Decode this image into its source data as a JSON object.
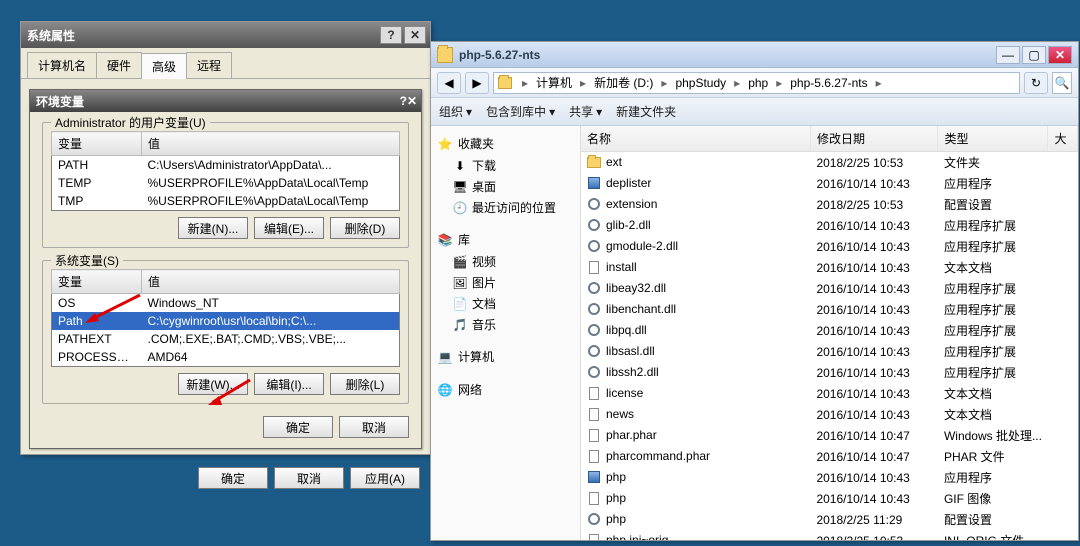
{
  "sysprops": {
    "title": "系统属性",
    "tabs": [
      "计算机名",
      "硬件",
      "高级",
      "远程"
    ],
    "active_tab": 2,
    "envdlg": {
      "title": "环境变量",
      "user_group_label": "Administrator 的用户变量(U)",
      "sys_group_label": "系统变量(S)",
      "col_var": "变量",
      "col_val": "值",
      "user_vars": [
        {
          "name": "PATH",
          "value": "C:\\Users\\Administrator\\AppData\\..."
        },
        {
          "name": "TEMP",
          "value": "%USERPROFILE%\\AppData\\Local\\Temp"
        },
        {
          "name": "TMP",
          "value": "%USERPROFILE%\\AppData\\Local\\Temp"
        }
      ],
      "sys_vars": [
        {
          "name": "OS",
          "value": "Windows_NT"
        },
        {
          "name": "Path",
          "value": "C:\\cygwinroot\\usr\\local\\bin;C:\\..."
        },
        {
          "name": "PATHEXT",
          "value": ".COM;.EXE;.BAT;.CMD;.VBS;.VBE;..."
        },
        {
          "name": "PROCESSOR_AR...",
          "value": "AMD64"
        }
      ],
      "sys_selected": 1,
      "btn_new_u": "新建(N)...",
      "btn_edit_u": "编辑(E)...",
      "btn_del_u": "删除(D)",
      "btn_new_s": "新建(W)...",
      "btn_edit_s": "编辑(I)...",
      "btn_del_s": "删除(L)",
      "btn_ok": "确定",
      "btn_cancel": "取消"
    },
    "btn_ok": "确定",
    "btn_cancel": "取消",
    "btn_apply": "应用(A)"
  },
  "explorer": {
    "title": "php-5.6.27-nts",
    "breadcrumb": [
      "计算机",
      "新加卷 (D:)",
      "phpStudy",
      "php",
      "php-5.6.27-nts"
    ],
    "toolbar": {
      "organize": "组织",
      "include": "包含到库中",
      "share": "共享",
      "newfolder": "新建文件夹"
    },
    "nav": {
      "favorites": "收藏夹",
      "fav_items": [
        "下载",
        "桌面",
        "最近访问的位置"
      ],
      "libraries": "库",
      "lib_items": [
        "视频",
        "图片",
        "文档",
        "音乐"
      ],
      "computer": "计算机",
      "network": "网络"
    },
    "columns": {
      "name": "名称",
      "date": "修改日期",
      "type": "类型",
      "size": "大"
    },
    "files": [
      {
        "icon": "folder",
        "name": "ext",
        "date": "2018/2/25 10:53",
        "type": "文件夹"
      },
      {
        "icon": "app",
        "name": "deplister",
        "date": "2016/10/14 10:43",
        "type": "应用程序"
      },
      {
        "icon": "gear",
        "name": "extension",
        "date": "2018/2/25 10:53",
        "type": "配置设置"
      },
      {
        "icon": "gear",
        "name": "glib-2.dll",
        "date": "2016/10/14 10:43",
        "type": "应用程序扩展"
      },
      {
        "icon": "gear",
        "name": "gmodule-2.dll",
        "date": "2016/10/14 10:43",
        "type": "应用程序扩展"
      },
      {
        "icon": "page",
        "name": "install",
        "date": "2016/10/14 10:43",
        "type": "文本文档"
      },
      {
        "icon": "gear",
        "name": "libeay32.dll",
        "date": "2016/10/14 10:43",
        "type": "应用程序扩展"
      },
      {
        "icon": "gear",
        "name": "libenchant.dll",
        "date": "2016/10/14 10:43",
        "type": "应用程序扩展"
      },
      {
        "icon": "gear",
        "name": "libpq.dll",
        "date": "2016/10/14 10:43",
        "type": "应用程序扩展"
      },
      {
        "icon": "gear",
        "name": "libsasl.dll",
        "date": "2016/10/14 10:43",
        "type": "应用程序扩展"
      },
      {
        "icon": "gear",
        "name": "libssh2.dll",
        "date": "2016/10/14 10:43",
        "type": "应用程序扩展"
      },
      {
        "icon": "page",
        "name": "license",
        "date": "2016/10/14 10:43",
        "type": "文本文档"
      },
      {
        "icon": "page",
        "name": "news",
        "date": "2016/10/14 10:43",
        "type": "文本文档"
      },
      {
        "icon": "page",
        "name": "phar.phar",
        "date": "2016/10/14 10:47",
        "type": "Windows 批处理..."
      },
      {
        "icon": "page",
        "name": "pharcommand.phar",
        "date": "2016/10/14 10:47",
        "type": "PHAR 文件"
      },
      {
        "icon": "app",
        "name": "php",
        "date": "2016/10/14 10:43",
        "type": "应用程序"
      },
      {
        "icon": "page",
        "name": "php",
        "date": "2016/10/14 10:43",
        "type": "GIF 图像"
      },
      {
        "icon": "gear",
        "name": "php",
        "date": "2018/2/25 11:29",
        "type": "配置设置"
      },
      {
        "icon": "page",
        "name": "php.ini~orig",
        "date": "2018/2/25 10:53",
        "type": "INI~ORIG 文件"
      }
    ]
  }
}
